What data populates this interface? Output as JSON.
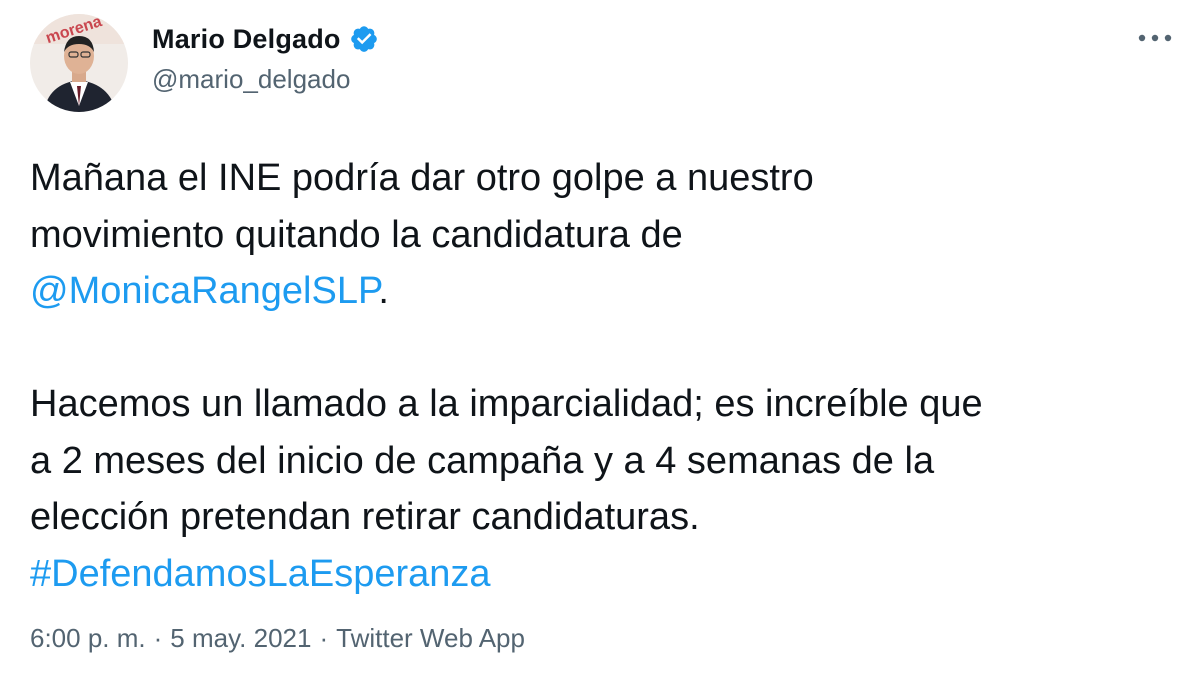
{
  "author": {
    "display_name": "Mario Delgado",
    "handle": "@mario_delgado",
    "verified": true,
    "avatar_icon": "profile-photo"
  },
  "more_icon": "more-horizontal-icon",
  "tweet": {
    "line1": "Mañana el INE podría dar otro golpe a nuestro",
    "line2": "movimiento quitando la candidatura de",
    "mention": "@MonicaRangelSLP",
    "mention_suffix": ".",
    "line4": "Hacemos un llamado a la imparcialidad; es increíble que",
    "line5": "a 2 meses del inicio de campaña y a 4 semanas de la",
    "line6": "elección pretendan retirar candidaturas.",
    "hashtag": "#DefendamosLaEsperanza"
  },
  "meta": {
    "time": "6:00 p. m.",
    "separator": "·",
    "date": "5 may. 2021",
    "source": "Twitter Web App"
  },
  "colors": {
    "link": "#1d9bf0",
    "text": "#0f1419",
    "secondary": "#536471",
    "verified_badge": "#1d9bf0"
  }
}
